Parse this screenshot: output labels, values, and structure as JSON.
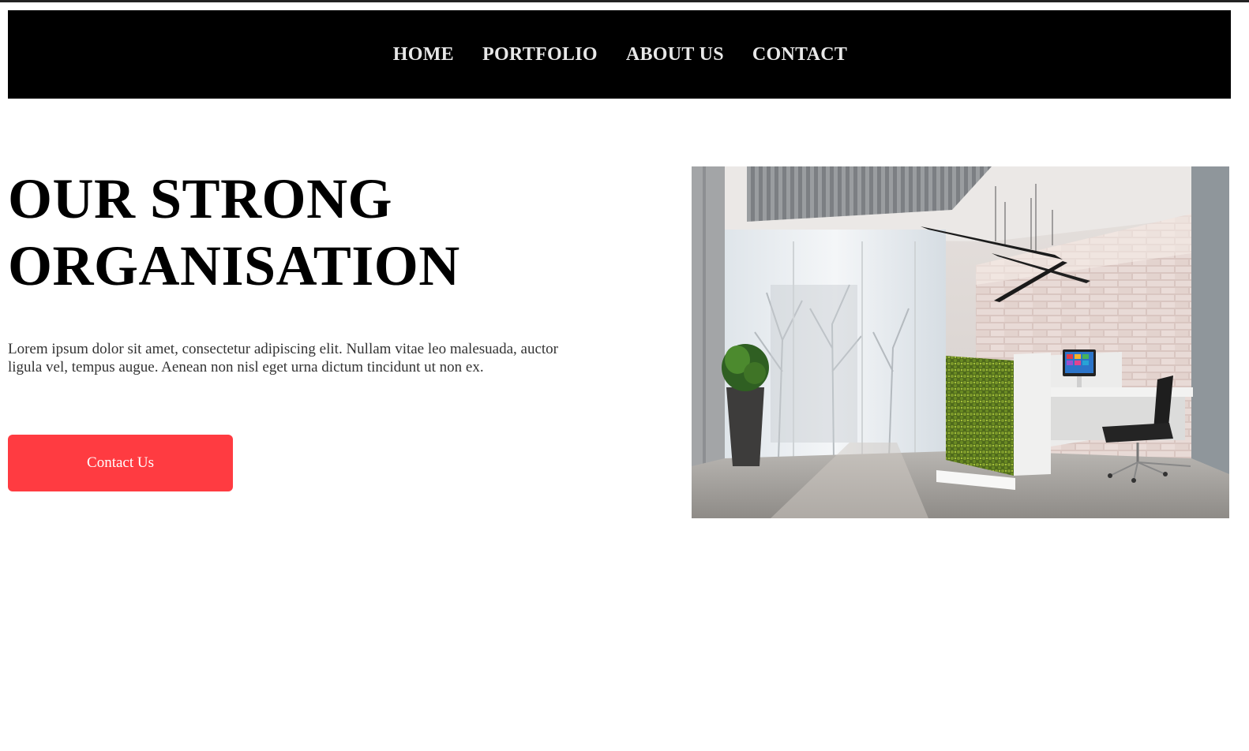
{
  "nav": {
    "items": [
      {
        "label": "HOME"
      },
      {
        "label": "PORTFOLIO"
      },
      {
        "label": "ABOUT US"
      },
      {
        "label": "CONTACT"
      }
    ]
  },
  "hero": {
    "title_line1": "OUR STRONG",
    "title_line2": "ORGANISATION",
    "description": "Lorem ipsum dolor sit amet, consectetur adipiscing elit. Nullam vitae leo malesuada, auctor ligula vel, tempus augue. Aenean non nisl eget urna dictum tincidunt ut non ex.",
    "cta_label": "Contact Us",
    "image_subject": "modern office reception interior"
  },
  "colors": {
    "nav_background": "#000000",
    "nav_text": "#e8e8e8",
    "cta_background": "#ff3b41",
    "cta_text": "#ffffff",
    "page_background": "#ffffff"
  }
}
